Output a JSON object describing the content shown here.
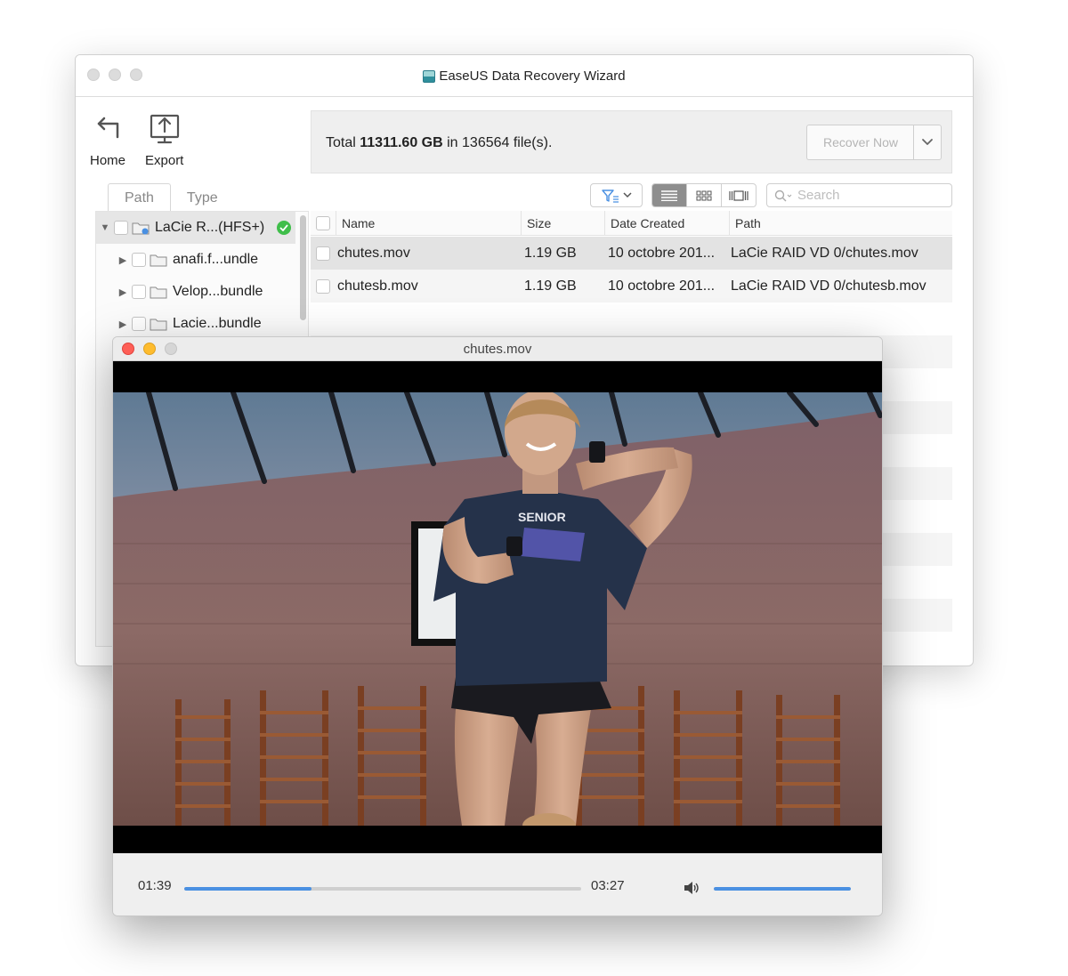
{
  "app": {
    "title": "EaseUS Data Recovery Wizard"
  },
  "toolbar": {
    "home_label": "Home",
    "export_label": "Export"
  },
  "summary": {
    "prefix": "Total ",
    "total_size": "11311.60 GB",
    "middle": " in ",
    "file_count": "136564",
    "suffix": " file(s)."
  },
  "recover": {
    "label": "Recover Now"
  },
  "tabs": [
    {
      "label": "Path"
    },
    {
      "label": "Type"
    }
  ],
  "search": {
    "placeholder": "Search"
  },
  "tree": {
    "items": [
      {
        "label": "LaCie R...(HFS+)",
        "expanded": true,
        "status": "ok"
      },
      {
        "label": "anafi.f...undle"
      },
      {
        "label": "Velop...bundle"
      },
      {
        "label": "Lacie...bundle"
      }
    ]
  },
  "list": {
    "columns": {
      "name": "Name",
      "size": "Size",
      "date": "Date Created",
      "path": "Path"
    },
    "rows": [
      {
        "name": "chutes.mov",
        "size": "1.19 GB",
        "date": "10 octobre 201...",
        "path": "LaCie RAID VD 0/chutes.mov"
      },
      {
        "name": "chutesb.mov",
        "size": "1.19 GB",
        "date": "10 octobre 201...",
        "path": "LaCie RAID VD 0/chutesb.mov"
      }
    ]
  },
  "player": {
    "title": "chutes.mov",
    "elapsed": "01:39",
    "duration": "03:27",
    "progress_fraction": 0.32,
    "volume_fraction": 1.0
  },
  "colors": {
    "accent": "#4a90e2",
    "ok": "#3fbe4a",
    "close": "#fe5f57",
    "minimize": "#febc2e"
  }
}
